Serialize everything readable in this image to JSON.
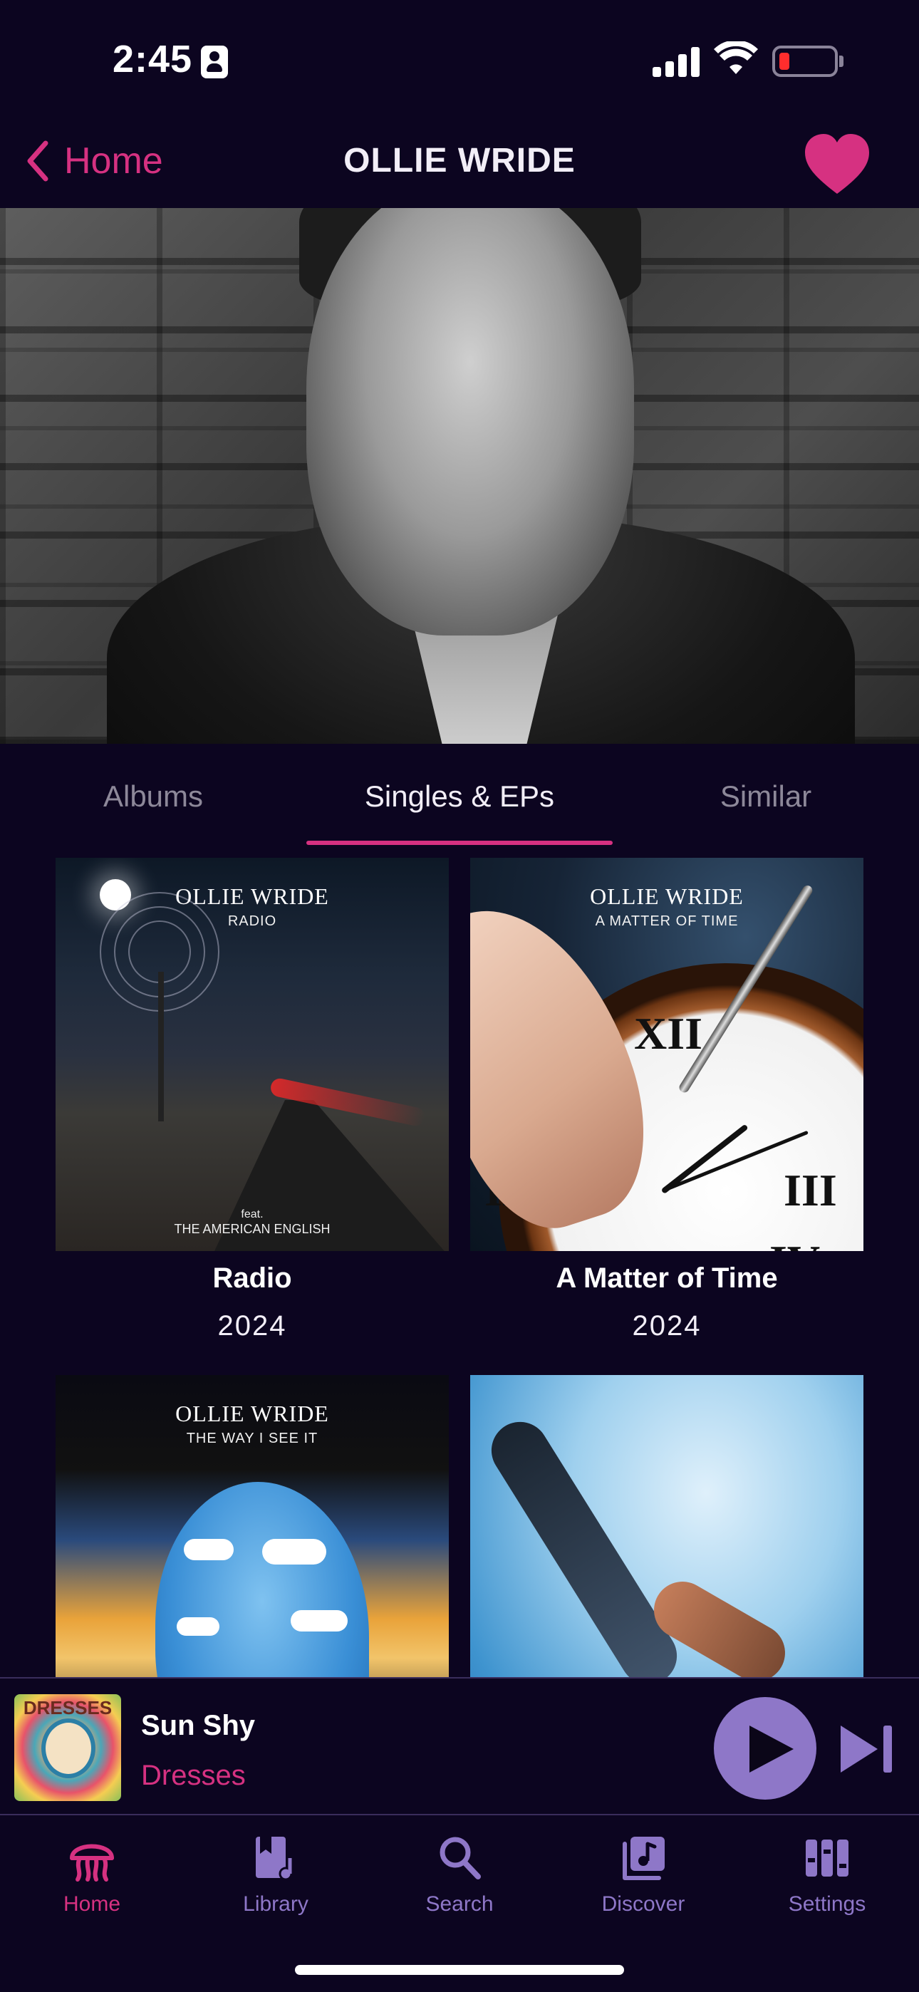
{
  "status_bar": {
    "time": "2:45"
  },
  "nav": {
    "back_label": "Home",
    "title": "OLLIE WRIDE"
  },
  "tabs": [
    {
      "label": "Albums"
    },
    {
      "label": "Singles & EPs"
    },
    {
      "label": "Similar"
    }
  ],
  "active_tab_index": 1,
  "releases": [
    {
      "title": "Radio",
      "year": "2024",
      "cover_artist": "OLLIE WRIDE",
      "cover_subtitle": "RADIO",
      "cover_feat": "feat.",
      "cover_feat_artist": "THE AMERICAN ENGLISH"
    },
    {
      "title": "A Matter of Time",
      "year": "2024",
      "cover_artist": "OLLIE WRIDE",
      "cover_subtitle": "A MATTER OF TIME"
    },
    {
      "cover_artist": "OLLIE WRIDE",
      "cover_subtitle": "THE WAY I SEE IT"
    },
    {}
  ],
  "now_playing": {
    "title": "Sun Shy",
    "artist": "Dresses",
    "art_text": "DRESSES"
  },
  "tab_bar": [
    {
      "label": "Home",
      "icon": "jellyfish-icon"
    },
    {
      "label": "Library",
      "icon": "library-icon"
    },
    {
      "label": "Search",
      "icon": "search-icon"
    },
    {
      "label": "Discover",
      "icon": "discover-icon"
    },
    {
      "label": "Settings",
      "icon": "settings-icon"
    }
  ],
  "colors": {
    "background": "#0c0520",
    "accent_pink": "#d63181",
    "accent_purple": "#8e77c8"
  }
}
